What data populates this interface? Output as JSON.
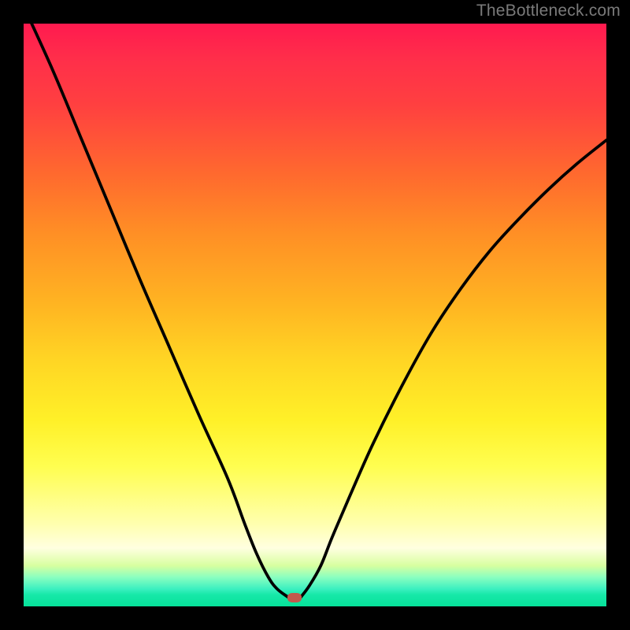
{
  "watermark": "TheBottleneck.com",
  "chart_data": {
    "type": "line",
    "title": "",
    "xlabel": "",
    "ylabel": "",
    "xlim": [
      0,
      100
    ],
    "ylim": [
      0,
      100
    ],
    "grid": false,
    "legend": false,
    "series": [
      {
        "name": "bottleneck-curve-left",
        "x": [
          0,
          5,
          10,
          15,
          20,
          25,
          30,
          35,
          38,
          40,
          42,
          43.5,
          45.5
        ],
        "y": [
          103,
          92,
          80,
          68,
          56,
          44.5,
          33,
          22,
          14,
          9,
          5,
          3,
          1.5
        ]
      },
      {
        "name": "bottleneck-curve-right",
        "x": [
          47.5,
          49,
          51,
          53,
          56,
          60,
          65,
          70,
          75,
          80,
          85,
          90,
          95,
          100
        ],
        "y": [
          1.5,
          3.5,
          7,
          12,
          19,
          28,
          38,
          47,
          54.5,
          61,
          66.5,
          71.5,
          76,
          80
        ]
      }
    ],
    "marker": {
      "x": 46.5,
      "y": 1.5,
      "color": "#c3584c"
    },
    "gradient_stops": [
      {
        "pos": 0,
        "color": "#ff1a4f"
      },
      {
        "pos": 50,
        "color": "#ffd624"
      },
      {
        "pos": 90,
        "color": "#ffffe0"
      },
      {
        "pos": 100,
        "color": "#06e29a"
      }
    ]
  }
}
